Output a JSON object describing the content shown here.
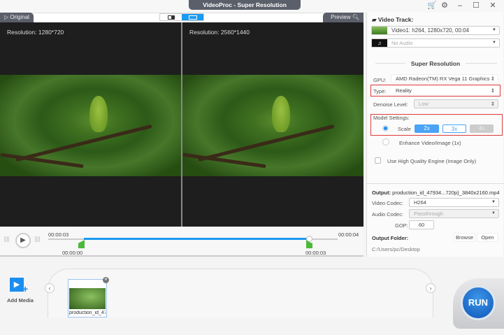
{
  "window": {
    "title": "VideoProc  -  Super Resolution"
  },
  "viewer": {
    "original_tab": "Original",
    "preview_tab": "Preview",
    "left_resolution": "Resolution: 1280*720",
    "right_resolution": "Resolution: 2560*1440"
  },
  "timeline": {
    "current_time": "00:00:03",
    "total_time": "00:00:04",
    "start_marker": "00:00:00",
    "end_marker": "00:00:03",
    "selection_start": 0.0,
    "selection_end": 0.75
  },
  "panel": {
    "video_track_label": "Video Track:",
    "video_track_value": "Video1: h264, 1280x720, 00:04",
    "audio_value": "No Audio",
    "section_title": "Super Resolution",
    "gpu_label": "GPU:",
    "gpu_value": "AMD Radeon(TM) RX Vega 11 Graphics",
    "type_label": "Type:",
    "type_value": "Reality",
    "denoise_label": "Denoise Level:",
    "denoise_value": "Low",
    "model_settings_label": "Model Settings:",
    "scale_label": "Scale",
    "scale_options": [
      "2x",
      "3x",
      "4x"
    ],
    "enhance_label": "Enhance Video/Image (1x)",
    "hq_label": "Use High Quality Engine (Image Only)",
    "output_label": "Output:",
    "output_file": "production_id_47934...720p)_3840x2160.mp4",
    "video_codec_label": "Video Codec:",
    "video_codec_value": "H264",
    "audio_codec_label": "Audio Codec:",
    "audio_codec_value": "Passthrough",
    "gop_label": "GOP:",
    "gop_value": "60",
    "output_folder_label": "Output Folder:",
    "browse": "Browse",
    "open": "Open",
    "folder_path": "C:/Users/pc/Desktop"
  },
  "media": {
    "add_media": "Add Media",
    "clip_name": "production_id_47",
    "run": "RUN"
  },
  "colors": {
    "accent": "#1a9af0",
    "red_highlight": "#e03b3b",
    "green_marker": "#4cb83a",
    "run": "#1565c0"
  }
}
